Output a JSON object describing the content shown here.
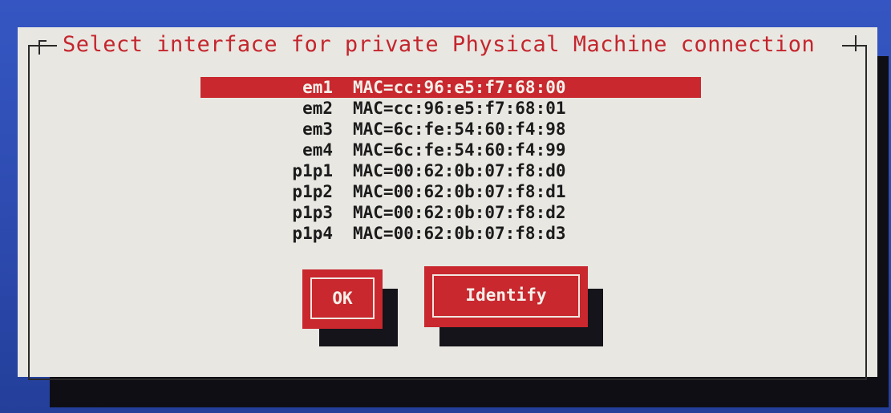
{
  "dialog": {
    "title": "Select interface for private Physical Machine connection",
    "selected_index": 0,
    "interfaces": [
      {
        "name": "em1",
        "mac": "MAC=cc:96:e5:f7:68:00"
      },
      {
        "name": "em2",
        "mac": "MAC=cc:96:e5:f7:68:01"
      },
      {
        "name": "em3",
        "mac": "MAC=6c:fe:54:60:f4:98"
      },
      {
        "name": "em4",
        "mac": "MAC=6c:fe:54:60:f4:99"
      },
      {
        "name": "p1p1",
        "mac": "MAC=00:62:0b:07:f8:d0"
      },
      {
        "name": "p1p2",
        "mac": "MAC=00:62:0b:07:f8:d1"
      },
      {
        "name": "p1p3",
        "mac": "MAC=00:62:0b:07:f8:d2"
      },
      {
        "name": "p1p4",
        "mac": "MAC=00:62:0b:07:f8:d3"
      }
    ],
    "buttons": {
      "ok_label": "OK",
      "identify_label": "Identify"
    }
  },
  "colors": {
    "accent": "#c8282e",
    "background": "#2f4fb5",
    "dialog": "#e9e7e2",
    "text": "#1b1b1b"
  }
}
